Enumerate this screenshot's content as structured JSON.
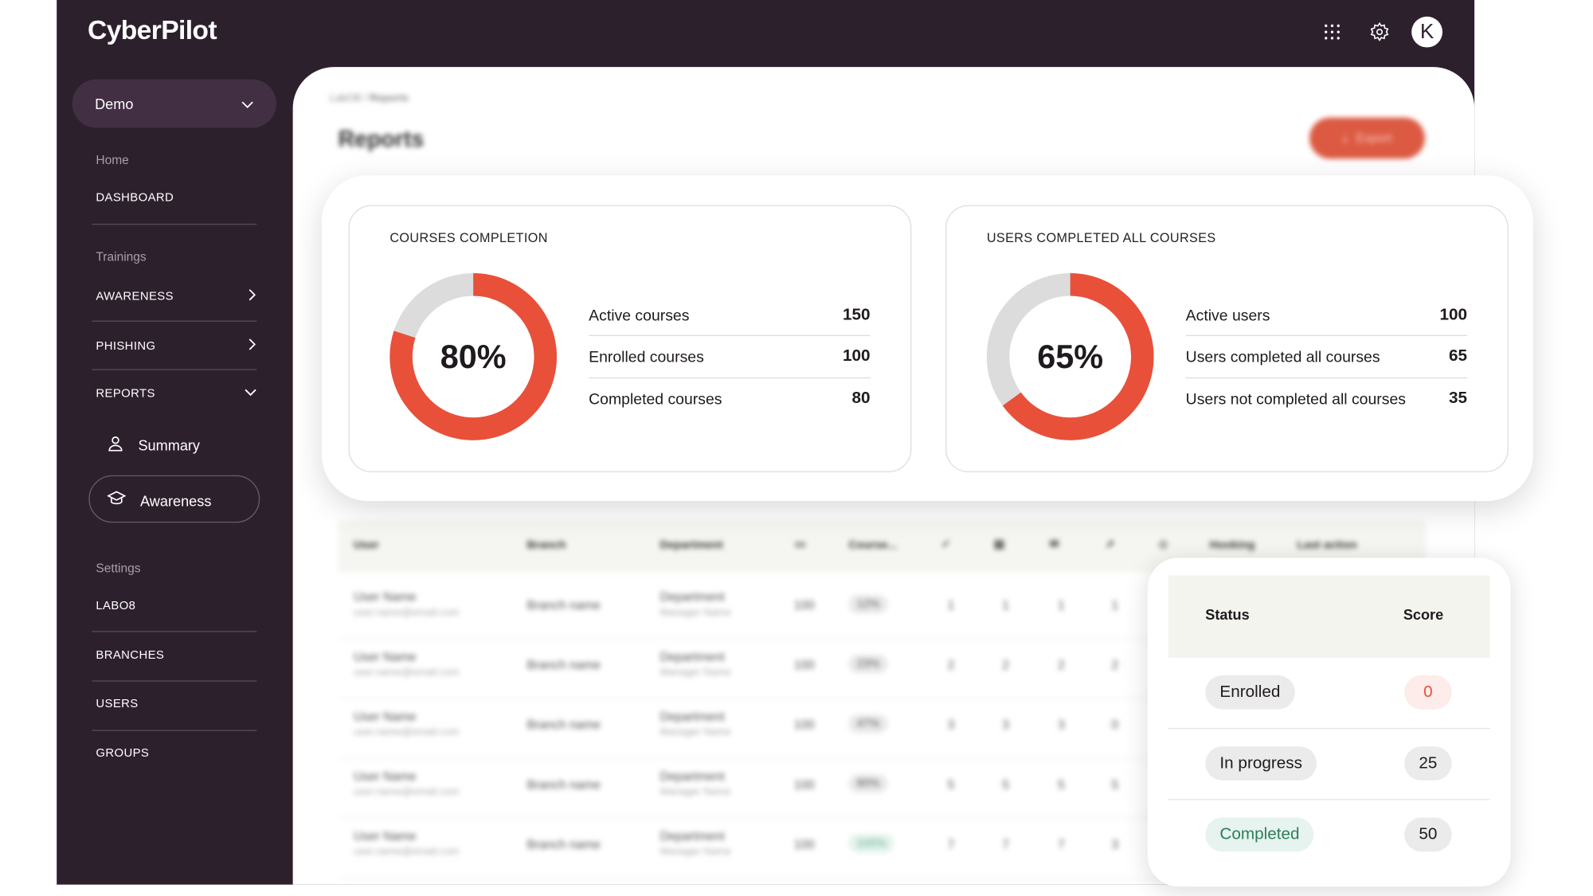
{
  "app": {
    "logo": "CyberPilot",
    "avatar_initial": "K"
  },
  "colors": {
    "frame": "#2d202d",
    "accent": "#e8503a",
    "track": "#dcdcdc",
    "completed_green": "#2e7d5b"
  },
  "sidebar": {
    "workspace": "Demo",
    "sections": [
      {
        "label": "Home"
      },
      {
        "label": "Trainings"
      },
      {
        "label": "Settings"
      }
    ],
    "items": [
      {
        "label": "DASHBOARD"
      },
      {
        "label": "AWARENESS"
      },
      {
        "label": "PHISHING"
      },
      {
        "label": "REPORTS"
      },
      {
        "label": "Summary"
      },
      {
        "label": "Awareness"
      },
      {
        "label": "LABO8"
      },
      {
        "label": "BRANCHES"
      },
      {
        "label": "USERS"
      },
      {
        "label": "GROUPS"
      }
    ]
  },
  "page": {
    "breadcrumb": [
      "LabO8",
      "Reports"
    ],
    "breadcrumb_sep": "/",
    "title": "Reports",
    "export_label": "Export"
  },
  "courses_card": {
    "title": "COURSES COMPLETION",
    "percent": 80,
    "percent_label": "80%",
    "rows": [
      {
        "label": "Active courses",
        "value": "150"
      },
      {
        "label": "Enrolled courses",
        "value": "100"
      },
      {
        "label": "Completed courses",
        "value": "80"
      }
    ]
  },
  "users_card": {
    "title": "USERS COMPLETED ALL COURSES",
    "percent": 65,
    "percent_label": "65%",
    "rows": [
      {
        "label": "Active users",
        "value": "100"
      },
      {
        "label": "Users completed all courses",
        "value": "65"
      },
      {
        "label": "Users not completed all courses",
        "value": "35"
      }
    ]
  },
  "table": {
    "headers": [
      "User",
      "Branch",
      "Department",
      "Course...",
      "Hooking",
      "Last action"
    ],
    "rows": [
      {
        "name": "User Name",
        "email": "user.name@email.com",
        "branch": "Branch name",
        "dept": "Department",
        "manager": "Manager Name",
        "total": "100",
        "pct": "12%",
        "c": [
          "1",
          "1",
          "1",
          "1"
        ]
      },
      {
        "name": "User Name",
        "email": "user.name@email.com",
        "branch": "Branch name",
        "dept": "Department",
        "manager": "Manager Name",
        "total": "100",
        "pct": "23%",
        "c": [
          "2",
          "2",
          "2",
          "2"
        ]
      },
      {
        "name": "User Name",
        "email": "user.name@email.com",
        "branch": "Branch name",
        "dept": "Department",
        "manager": "Manager Name",
        "total": "100",
        "pct": "47%",
        "c": [
          "3",
          "3",
          "3",
          "0"
        ]
      },
      {
        "name": "User Name",
        "email": "user.name@email.com",
        "branch": "Branch name",
        "dept": "Department",
        "manager": "Manager Name",
        "total": "100",
        "pct": "80%",
        "c": [
          "5",
          "5",
          "5",
          "5"
        ]
      },
      {
        "name": "User Name",
        "email": "user.name@email.com",
        "branch": "Branch name",
        "dept": "Department",
        "manager": "Manager Name",
        "total": "100",
        "pct": "100%",
        "c": [
          "7",
          "7",
          "7",
          "3"
        ]
      }
    ]
  },
  "status_card": {
    "headers": {
      "status": "Status",
      "score": "Score"
    },
    "rows": [
      {
        "status": "Enrolled",
        "score": "0"
      },
      {
        "status": "In progress",
        "score": "25"
      },
      {
        "status": "Completed",
        "score": "50"
      }
    ]
  }
}
